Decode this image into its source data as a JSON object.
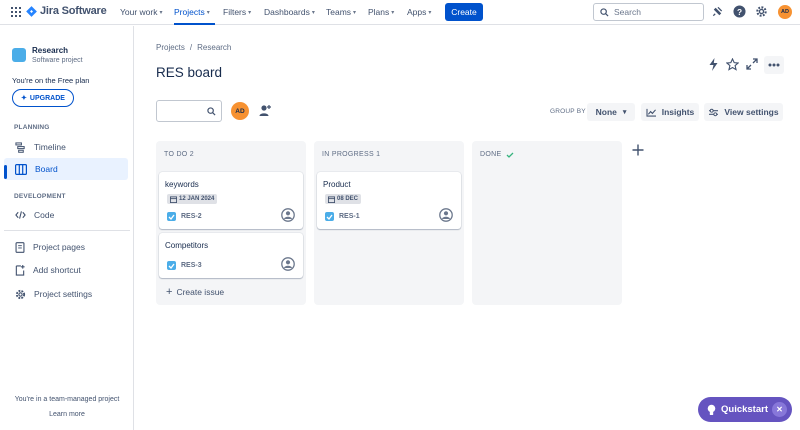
{
  "topnav": {
    "product": "Jira Software",
    "items": [
      {
        "label": "Your work"
      },
      {
        "label": "Projects"
      },
      {
        "label": "Filters"
      },
      {
        "label": "Dashboards"
      },
      {
        "label": "Teams"
      },
      {
        "label": "Plans"
      },
      {
        "label": "Apps"
      }
    ],
    "create_label": "Create",
    "search_placeholder": "Search",
    "avatar_initials": "AD"
  },
  "sidebar": {
    "project_name": "Research",
    "project_type": "Software project",
    "plan_text": "You're on the Free plan",
    "upgrade_label": "UPGRADE",
    "planning_header": "PLANNING",
    "development_header": "DEVELOPMENT",
    "items": [
      {
        "label": "Timeline",
        "icon": "timeline-icon"
      },
      {
        "label": "Board",
        "icon": "board-icon"
      },
      {
        "label": "Code",
        "icon": "code-icon"
      },
      {
        "label": "Project pages",
        "icon": "pages-icon"
      },
      {
        "label": "Add shortcut",
        "icon": "add-shortcut-icon"
      },
      {
        "label": "Project settings",
        "icon": "gear-icon"
      }
    ],
    "footer_text": "You're in a team-managed project",
    "learn_more": "Learn more"
  },
  "main": {
    "breadcrumb": [
      "Projects",
      "/",
      "Research"
    ],
    "title": "RES board",
    "avatar_initials": "AD",
    "group_by_label": "GROUP BY",
    "group_by_value": "None",
    "insights_label": "Insights",
    "view_settings_label": "View settings"
  },
  "columns": [
    {
      "title": "TO DO 2",
      "cards": [
        {
          "title": "keywords",
          "date": "12 JAN 2024",
          "key": "RES-2"
        },
        {
          "title": "Competitors",
          "date": "",
          "key": "RES-3"
        }
      ],
      "create_label": "Create issue"
    },
    {
      "title": "IN PROGRESS 1",
      "cards": [
        {
          "title": "Product",
          "date": "08 DEC",
          "key": "RES-1"
        }
      ]
    },
    {
      "title": "DONE",
      "cards": []
    }
  ],
  "quickstart": {
    "label": "Quickstart"
  },
  "colors": {
    "accent": "#0052cc",
    "avatar": "#f79232",
    "quickstart": "#6554c0"
  }
}
